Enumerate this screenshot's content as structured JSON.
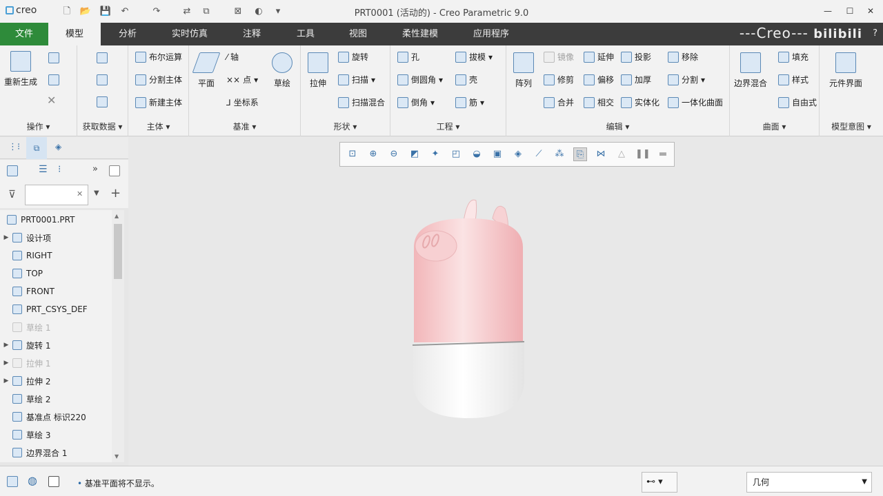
{
  "app": {
    "logo": "creo",
    "title": "PRT0001 (活动的) - Creo Parametric 9.0",
    "brand": "---Creo---",
    "bilibili": "bilibili",
    "help": "?"
  },
  "quick_access": [
    "new-icon",
    "open-icon",
    "save-icon",
    "undo-icon",
    "redo-icon",
    "regenerate-icon",
    "windows-icon",
    "close-window-icon",
    "appearance-icon",
    "customize-icon"
  ],
  "window_controls": {
    "minimize": "—",
    "maximize": "☐",
    "close": "✕"
  },
  "tabs": [
    "文件",
    "模型",
    "分析",
    "实时仿真",
    "注释",
    "工具",
    "视图",
    "柔性建模",
    "应用程序"
  ],
  "ribbon": {
    "operations": {
      "label": "操作",
      "regenerate": "重新生成"
    },
    "get_data": {
      "label": "获取数据"
    },
    "body": {
      "label": "主体",
      "items": [
        "布尔运算",
        "分割主体",
        "新建主体"
      ]
    },
    "datum": {
      "label": "基准",
      "plane": "平面",
      "axis": "轴",
      "point": "点",
      "csys": "坐标系",
      "sketch": "草绘"
    },
    "shapes": {
      "label": "形状",
      "extrude": "拉伸",
      "revolve": "旋转",
      "sweep": "扫描",
      "swept_blend": "扫描混合"
    },
    "engineering": {
      "label": "工程",
      "hole": "孔",
      "round": "倒圆角",
      "chamfer": "倒角",
      "draft": "拔模",
      "shell": "壳",
      "rib": "筋"
    },
    "editing": {
      "label": "编辑",
      "pattern": "阵列",
      "mirror": "镜像",
      "trim": "修剪",
      "merge": "合并",
      "extend": "延伸",
      "offset": "偏移",
      "intersect": "相交",
      "project": "投影",
      "thicken": "加厚",
      "solidify": "实体化",
      "remove": "移除",
      "split": "分割",
      "unify": "一体化曲面"
    },
    "surfaces": {
      "label": "曲面",
      "boundary_blend": "边界混合",
      "fill": "填充",
      "style": "样式",
      "freestyle": "自由式"
    },
    "model_intent": {
      "label": "模型意图",
      "component_interface": "元件界面"
    }
  },
  "model_tree": {
    "root": "PRT0001.PRT",
    "nodes": [
      {
        "label": "设计项",
        "expand": "▶",
        "dim": false
      },
      {
        "label": "RIGHT",
        "expand": "",
        "dim": false
      },
      {
        "label": "TOP",
        "expand": "",
        "dim": false
      },
      {
        "label": "FRONT",
        "expand": "",
        "dim": false
      },
      {
        "label": "PRT_CSYS_DEF",
        "expand": "",
        "dim": false
      },
      {
        "label": "草绘 1",
        "expand": "",
        "dim": true
      },
      {
        "label": "旋转 1",
        "expand": "▶",
        "dim": false
      },
      {
        "label": "拉伸 1",
        "expand": "▶",
        "dim": true
      },
      {
        "label": "拉伸 2",
        "expand": "▶",
        "dim": false
      },
      {
        "label": "草绘 2",
        "expand": "",
        "dim": false
      },
      {
        "label": "基准点 标识220",
        "expand": "",
        "dim": false
      },
      {
        "label": "草绘 3",
        "expand": "",
        "dim": false
      },
      {
        "label": "边界混合 1",
        "expand": "",
        "dim": false
      }
    ]
  },
  "search": {
    "value": "",
    "clear": "✕"
  },
  "status": {
    "message": "基准平面将不显示。",
    "filter": "几何"
  },
  "colors": {
    "file_tab": "#2e8b3a",
    "tabbar": "#3c3c3c",
    "pig_pink": "#f6c6c8",
    "body_white": "#ffffff"
  }
}
